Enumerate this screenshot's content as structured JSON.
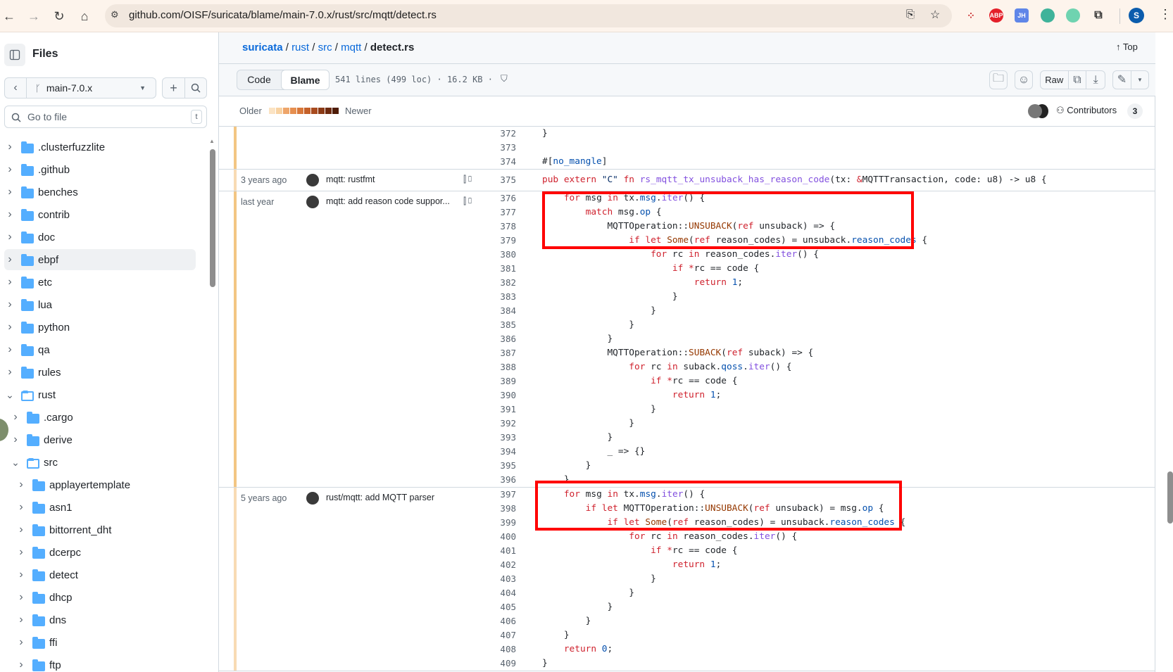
{
  "browser": {
    "url": "github.com/OISF/suricata/blame/main-7.0.x/rust/src/mqtt/detect.rs",
    "profile_initial": "S",
    "extensions": [
      "ABP",
      "JH"
    ]
  },
  "sidebar": {
    "title": "Files",
    "branch": "main-7.0.x",
    "search_placeholder": "Go to file",
    "search_shortcut": "t",
    "items": [
      {
        "label": ".clusterfuzzlite",
        "depth": 0,
        "open": false
      },
      {
        "label": ".github",
        "depth": 0,
        "open": false
      },
      {
        "label": "benches",
        "depth": 0,
        "open": false
      },
      {
        "label": "contrib",
        "depth": 0,
        "open": false
      },
      {
        "label": "doc",
        "depth": 0,
        "open": false
      },
      {
        "label": "ebpf",
        "depth": 0,
        "open": false,
        "hover": true
      },
      {
        "label": "etc",
        "depth": 0,
        "open": false
      },
      {
        "label": "lua",
        "depth": 0,
        "open": false
      },
      {
        "label": "python",
        "depth": 0,
        "open": false
      },
      {
        "label": "qa",
        "depth": 0,
        "open": false
      },
      {
        "label": "rules",
        "depth": 0,
        "open": false
      },
      {
        "label": "rust",
        "depth": 0,
        "open": true
      },
      {
        "label": ".cargo",
        "depth": 1,
        "open": false
      },
      {
        "label": "derive",
        "depth": 1,
        "open": false
      },
      {
        "label": "src",
        "depth": 1,
        "open": true
      },
      {
        "label": "applayertemplate",
        "depth": 2,
        "open": false
      },
      {
        "label": "asn1",
        "depth": 2,
        "open": false
      },
      {
        "label": "bittorrent_dht",
        "depth": 2,
        "open": false
      },
      {
        "label": "dcerpc",
        "depth": 2,
        "open": false
      },
      {
        "label": "detect",
        "depth": 2,
        "open": false
      },
      {
        "label": "dhcp",
        "depth": 2,
        "open": false
      },
      {
        "label": "dns",
        "depth": 2,
        "open": false
      },
      {
        "label": "ffi",
        "depth": 2,
        "open": false
      },
      {
        "label": "ftp",
        "depth": 2,
        "open": false
      }
    ]
  },
  "header": {
    "breadcrumb": [
      "suricata",
      "rust",
      "src",
      "mqtt"
    ],
    "file": "detect.rs",
    "top_label": "Top"
  },
  "toolbar": {
    "code_tab": "Code",
    "blame_tab": "Blame",
    "file_info": "541 lines (499 loc) · 16.2 KB ·",
    "raw_label": "Raw"
  },
  "legend": {
    "older": "Older",
    "newer": "Newer",
    "colors": [
      "#fbe3c3",
      "#f8d2a2",
      "#eea56a",
      "#e68f4f",
      "#d8783a",
      "#c4612a",
      "#a84b1f",
      "#8b3a16",
      "#6d2a0f",
      "#4e1c07"
    ]
  },
  "contributors": {
    "label": "Contributors",
    "count": "3"
  },
  "highlight_color": "#ff0000",
  "blame": [
    {
      "date": "",
      "message": "",
      "reblame": false,
      "age_color": "#f3c683",
      "lines": [
        {
          "n": "372",
          "t": [
            [
              "",
              "}"
            ]
          ]
        },
        {
          "n": "373",
          "t": []
        },
        {
          "n": "374",
          "t": [
            [
              "",
              "#["
            ],
            [
              "m",
              "no_mangle"
            ],
            [
              "",
              "]"
            ]
          ]
        }
      ]
    },
    {
      "date": "3 years ago",
      "message": "mqtt: rustfmt",
      "reblame": true,
      "age_color": "#f8dbb4",
      "lines": [
        {
          "n": "375",
          "t": [
            [
              "k",
              "pub extern "
            ],
            [
              "s",
              "\"C\""
            ],
            [
              "k",
              " fn "
            ],
            [
              "f",
              "rs_mqtt_tx_unsuback_has_reason_code"
            ],
            [
              "",
              "(tx: "
            ],
            [
              "k",
              "&"
            ],
            [
              "",
              "MQTTTransaction, code: u8) -> u8 {"
            ]
          ]
        }
      ]
    },
    {
      "date": "last year",
      "message": "mqtt: add reason code suppor...",
      "reblame": true,
      "age_color": "#f3c683",
      "lines": [
        {
          "n": "376",
          "t": [
            [
              "",
              "    "
            ],
            [
              "k",
              "for"
            ],
            [
              "",
              " msg "
            ],
            [
              "k",
              "in"
            ],
            [
              "",
              " tx."
            ],
            [
              "m",
              "msg"
            ],
            [
              "",
              "."
            ],
            [
              "f",
              "iter"
            ],
            [
              "",
              "() {"
            ]
          ]
        },
        {
          "n": "377",
          "t": [
            [
              "",
              "        "
            ],
            [
              "k",
              "match"
            ],
            [
              "",
              " msg."
            ],
            [
              "m",
              "op"
            ],
            [
              "",
              " {"
            ]
          ]
        },
        {
          "n": "378",
          "t": [
            [
              "",
              "            MQTTOperation::"
            ],
            [
              "t",
              "UNSUBACK"
            ],
            [
              "",
              "("
            ],
            [
              "k",
              "ref"
            ],
            [
              "",
              " unsuback) => {"
            ]
          ]
        },
        {
          "n": "379",
          "t": [
            [
              "",
              "                "
            ],
            [
              "k",
              "if let "
            ],
            [
              "t",
              "Some"
            ],
            [
              "",
              "("
            ],
            [
              "k",
              "ref"
            ],
            [
              "",
              " reason_codes) = unsuback."
            ],
            [
              "m",
              "reason_codes"
            ],
            [
              "",
              " {"
            ]
          ]
        },
        {
          "n": "380",
          "t": [
            [
              "",
              "                    "
            ],
            [
              "k",
              "for"
            ],
            [
              "",
              " rc "
            ],
            [
              "k",
              "in"
            ],
            [
              "",
              " reason_codes."
            ],
            [
              "f",
              "iter"
            ],
            [
              "",
              "() {"
            ]
          ]
        },
        {
          "n": "381",
          "t": [
            [
              "",
              "                        "
            ],
            [
              "k",
              "if"
            ],
            [
              "",
              " "
            ],
            [
              "k",
              "*"
            ],
            [
              "",
              "rc == code {"
            ]
          ]
        },
        {
          "n": "382",
          "t": [
            [
              "",
              "                            "
            ],
            [
              "k",
              "return"
            ],
            [
              "",
              " "
            ],
            [
              "n",
              "1"
            ],
            [
              "",
              ";"
            ]
          ]
        },
        {
          "n": "383",
          "t": [
            [
              "",
              "                        }"
            ]
          ]
        },
        {
          "n": "384",
          "t": [
            [
              "",
              "                    }"
            ]
          ]
        },
        {
          "n": "385",
          "t": [
            [
              "",
              "                }"
            ]
          ]
        },
        {
          "n": "386",
          "t": [
            [
              "",
              "            }"
            ]
          ]
        },
        {
          "n": "387",
          "t": [
            [
              "",
              "            MQTTOperation::"
            ],
            [
              "t",
              "SUBACK"
            ],
            [
              "",
              "("
            ],
            [
              "k",
              "ref"
            ],
            [
              "",
              " suback) => {"
            ]
          ]
        },
        {
          "n": "388",
          "t": [
            [
              "",
              "                "
            ],
            [
              "k",
              "for"
            ],
            [
              "",
              " rc "
            ],
            [
              "k",
              "in"
            ],
            [
              "",
              " suback."
            ],
            [
              "m",
              "qoss"
            ],
            [
              "",
              "."
            ],
            [
              "f",
              "iter"
            ],
            [
              "",
              "() {"
            ]
          ]
        },
        {
          "n": "389",
          "t": [
            [
              "",
              "                    "
            ],
            [
              "k",
              "if"
            ],
            [
              "",
              " "
            ],
            [
              "k",
              "*"
            ],
            [
              "",
              "rc == code {"
            ]
          ]
        },
        {
          "n": "390",
          "t": [
            [
              "",
              "                        "
            ],
            [
              "k",
              "return"
            ],
            [
              "",
              " "
            ],
            [
              "n",
              "1"
            ],
            [
              "",
              ";"
            ]
          ]
        },
        {
          "n": "391",
          "t": [
            [
              "",
              "                    }"
            ]
          ]
        },
        {
          "n": "392",
          "t": [
            [
              "",
              "                }"
            ]
          ]
        },
        {
          "n": "393",
          "t": [
            [
              "",
              "            }"
            ]
          ]
        },
        {
          "n": "394",
          "t": [
            [
              "",
              "            _ => {}"
            ]
          ]
        },
        {
          "n": "395",
          "t": [
            [
              "",
              "        }"
            ]
          ]
        },
        {
          "n": "396",
          "t": [
            [
              "",
              "    }"
            ]
          ]
        }
      ]
    },
    {
      "date": "5 years ago",
      "message": "rust/mqtt: add MQTT parser",
      "reblame": false,
      "age_color": "#f8dbb4",
      "lines": [
        {
          "n": "397",
          "t": [
            [
              "",
              "    "
            ],
            [
              "k",
              "for"
            ],
            [
              "",
              " msg "
            ],
            [
              "k",
              "in"
            ],
            [
              "",
              " tx."
            ],
            [
              "m",
              "msg"
            ],
            [
              "",
              "."
            ],
            [
              "f",
              "iter"
            ],
            [
              "",
              "() {"
            ]
          ]
        },
        {
          "n": "398",
          "t": [
            [
              "",
              "        "
            ],
            [
              "k",
              "if let"
            ],
            [
              "",
              " MQTTOperation::"
            ],
            [
              "t",
              "UNSUBACK"
            ],
            [
              "",
              "("
            ],
            [
              "k",
              "ref"
            ],
            [
              "",
              " unsuback) = msg."
            ],
            [
              "m",
              "op"
            ],
            [
              "",
              " {"
            ]
          ]
        },
        {
          "n": "399",
          "t": [
            [
              "",
              "            "
            ],
            [
              "k",
              "if let "
            ],
            [
              "t",
              "Some"
            ],
            [
              "",
              "("
            ],
            [
              "k",
              "ref"
            ],
            [
              "",
              " reason_codes) = unsuback."
            ],
            [
              "m",
              "reason_codes"
            ],
            [
              "",
              " {"
            ]
          ]
        },
        {
          "n": "400",
          "t": [
            [
              "",
              "                "
            ],
            [
              "k",
              "for"
            ],
            [
              "",
              " rc "
            ],
            [
              "k",
              "in"
            ],
            [
              "",
              " reason_codes."
            ],
            [
              "f",
              "iter"
            ],
            [
              "",
              "() {"
            ]
          ]
        },
        {
          "n": "401",
          "t": [
            [
              "",
              "                    "
            ],
            [
              "k",
              "if"
            ],
            [
              "",
              " "
            ],
            [
              "k",
              "*"
            ],
            [
              "",
              "rc == code {"
            ]
          ]
        },
        {
          "n": "402",
          "t": [
            [
              "",
              "                        "
            ],
            [
              "k",
              "return"
            ],
            [
              "",
              " "
            ],
            [
              "n",
              "1"
            ],
            [
              "",
              ";"
            ]
          ]
        },
        {
          "n": "403",
          "t": [
            [
              "",
              "                    }"
            ]
          ]
        },
        {
          "n": "404",
          "t": [
            [
              "",
              "                }"
            ]
          ]
        },
        {
          "n": "405",
          "t": [
            [
              "",
              "            }"
            ]
          ]
        },
        {
          "n": "406",
          "t": [
            [
              "",
              "        }"
            ]
          ]
        },
        {
          "n": "407",
          "t": [
            [
              "",
              "    }"
            ]
          ]
        },
        {
          "n": "408",
          "t": [
            [
              "",
              "    "
            ],
            [
              "k",
              "return"
            ],
            [
              "",
              " "
            ],
            [
              "n",
              "0"
            ],
            [
              "",
              ";"
            ]
          ]
        },
        {
          "n": "409",
          "t": [
            [
              "",
              "}"
            ]
          ]
        }
      ]
    }
  ]
}
